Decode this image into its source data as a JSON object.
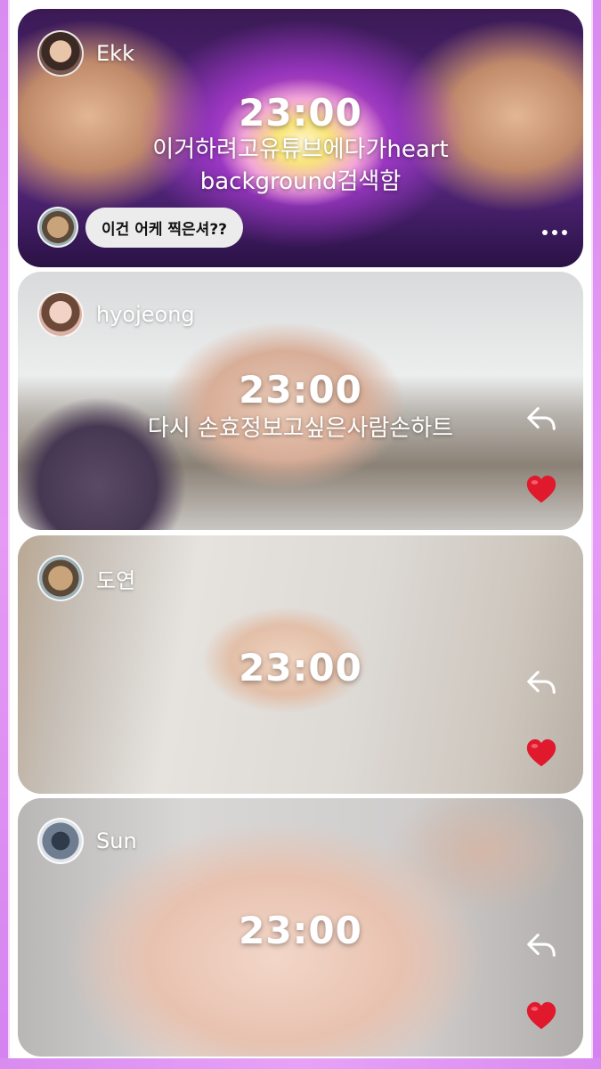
{
  "posts": [
    {
      "username": "Ekk",
      "time": "23:00",
      "caption_line1": "이거하려고유튜브에다가heart",
      "caption_line2": "background검색함",
      "comment": "이건 어케 찍은셔??",
      "more_icon": "more-dots-icon"
    },
    {
      "username": "hyojeong",
      "time": "23:00",
      "caption_line1": "다시 손효정보고싶은사람손하트",
      "reply_icon": "reply-icon",
      "heart_icon": "heart-icon"
    },
    {
      "username": "도연",
      "time": "23:00",
      "reply_icon": "reply-icon",
      "heart_icon": "heart-icon"
    },
    {
      "username": "Sun",
      "time": "23:00",
      "reply_icon": "reply-icon",
      "heart_icon": "heart-icon"
    }
  ],
  "colors": {
    "frame": "#e29af5",
    "heart": "#e0192d"
  }
}
